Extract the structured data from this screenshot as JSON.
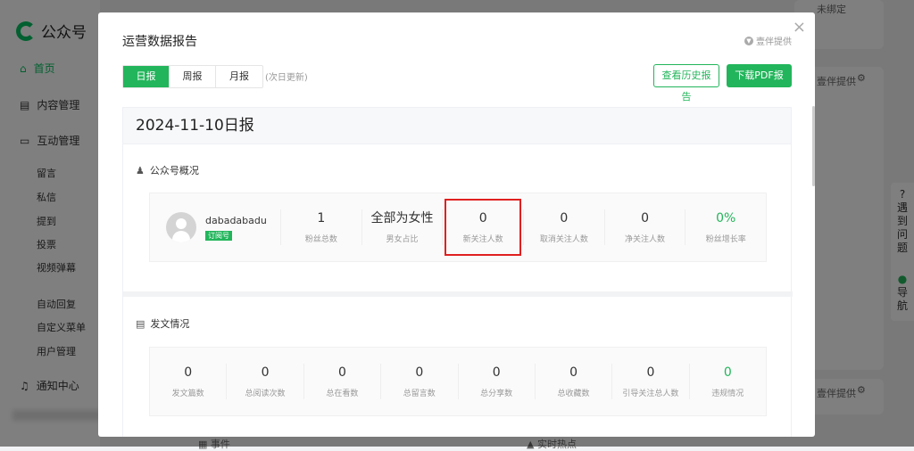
{
  "app": {
    "brand": "公众号"
  },
  "sidebar": {
    "items": [
      {
        "label": "首页",
        "icon": "home-icon",
        "active": true
      },
      {
        "label": "内容管理",
        "icon": "document-icon"
      },
      {
        "label": "互动管理",
        "icon": "chat-icon"
      },
      {
        "label": "留言"
      },
      {
        "label": "私信"
      },
      {
        "label": "提到"
      },
      {
        "label": "投票"
      },
      {
        "label": "视频弹幕"
      },
      {
        "label": "自动回复"
      },
      {
        "label": "自定义菜单"
      },
      {
        "label": "用户管理"
      },
      {
        "label": "通知中心",
        "icon": "bell-icon"
      }
    ]
  },
  "background": {
    "unbound": "未绑定",
    "provider1": "壹伴提供",
    "provider2": "壹伴提供",
    "events": "事件",
    "hot": "实时热点",
    "help": [
      "?",
      "遇",
      "到",
      "问",
      "题"
    ],
    "nav": [
      "导",
      "航"
    ]
  },
  "modal": {
    "title": "运营数据报告",
    "provider": "壹伴提供",
    "close": "×",
    "tabs": [
      {
        "label": "日报",
        "active": true
      },
      {
        "label": "周报"
      },
      {
        "label": "月报"
      }
    ],
    "tab_note": "(次日更新)",
    "history_button": "查看历史报告",
    "download_button": "下载PDF报告",
    "report_title": "2024-11-10日报",
    "overview": {
      "title": "公众号概况",
      "account_name": "dabadabadu",
      "account_type": "订阅号",
      "stats": [
        {
          "value": "1",
          "label": "粉丝总数"
        },
        {
          "value": "全部为女性",
          "label": "男女占比"
        },
        {
          "value": "0",
          "label": "新关注人数",
          "highlighted": true
        },
        {
          "value": "0",
          "label": "取消关注人数"
        },
        {
          "value": "0",
          "label": "净关注人数"
        },
        {
          "value": "0%",
          "label": "粉丝增长率",
          "green": true
        }
      ]
    },
    "posts": {
      "title": "发文情况",
      "stats": [
        {
          "value": "0",
          "label": "发文篇数"
        },
        {
          "value": "0",
          "label": "总阅读次数"
        },
        {
          "value": "0",
          "label": "总在看数"
        },
        {
          "value": "0",
          "label": "总留言数"
        },
        {
          "value": "0",
          "label": "总分享数"
        },
        {
          "value": "0",
          "label": "总收藏数"
        },
        {
          "value": "0",
          "label": "引导关注总人数"
        },
        {
          "value": "0",
          "label": "违规情况",
          "green": true
        }
      ]
    }
  },
  "colors": {
    "accent": "#22b55b",
    "highlight": "#e02020"
  }
}
